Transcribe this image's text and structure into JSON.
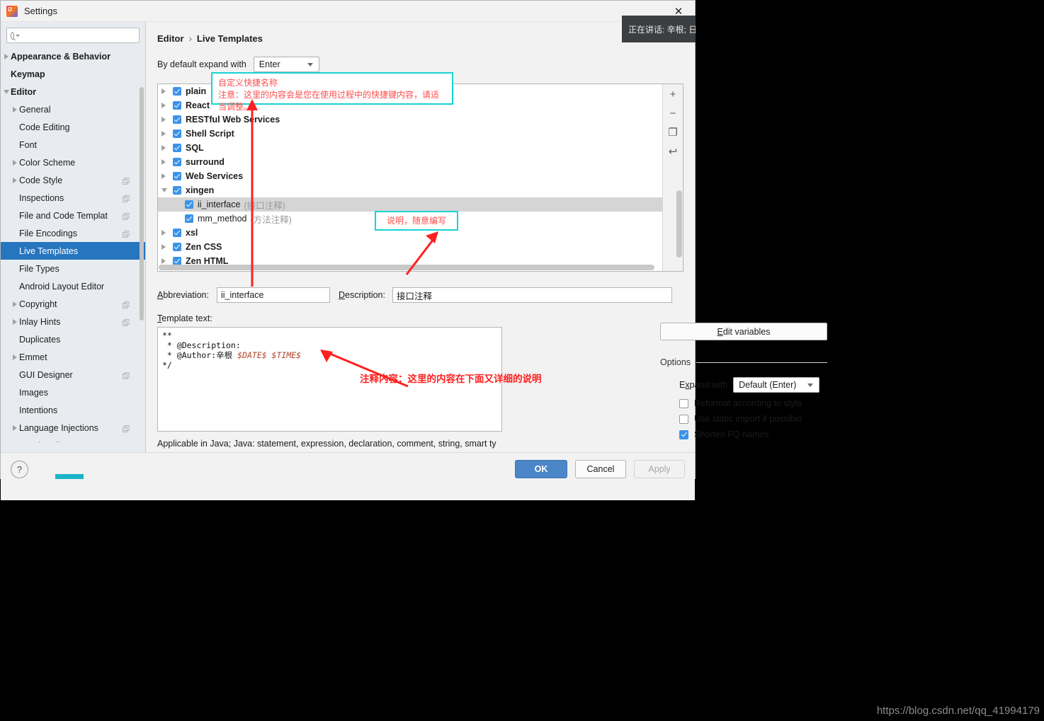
{
  "window": {
    "title": "Settings",
    "logo_icon": "intellij-logo-icon",
    "close_icon": "close-icon"
  },
  "search": {
    "value": "",
    "placeholder": "",
    "icon": "search-icon"
  },
  "sidebar": {
    "items": [
      {
        "label": "Appearance & Behavior",
        "level": 0,
        "arrow": "right",
        "badge": false,
        "selected": false
      },
      {
        "label": "Keymap",
        "level": 0,
        "arrow": "none",
        "badge": false,
        "selected": false
      },
      {
        "label": "Editor",
        "level": 0,
        "arrow": "down",
        "badge": false,
        "selected": false
      },
      {
        "label": "General",
        "level": 1,
        "arrow": "right",
        "badge": false,
        "selected": false
      },
      {
        "label": "Code Editing",
        "level": 1,
        "arrow": "none",
        "badge": false,
        "selected": false
      },
      {
        "label": "Font",
        "level": 1,
        "arrow": "none",
        "badge": false,
        "selected": false
      },
      {
        "label": "Color Scheme",
        "level": 1,
        "arrow": "right",
        "badge": false,
        "selected": false
      },
      {
        "label": "Code Style",
        "level": 1,
        "arrow": "right",
        "badge": true,
        "selected": false
      },
      {
        "label": "Inspections",
        "level": 1,
        "arrow": "none",
        "badge": true,
        "selected": false
      },
      {
        "label": "File and Code Templat",
        "level": 1,
        "arrow": "none",
        "badge": true,
        "selected": false
      },
      {
        "label": "File Encodings",
        "level": 1,
        "arrow": "none",
        "badge": true,
        "selected": false
      },
      {
        "label": "Live Templates",
        "level": 1,
        "arrow": "none",
        "badge": false,
        "selected": true
      },
      {
        "label": "File Types",
        "level": 1,
        "arrow": "none",
        "badge": false,
        "selected": false
      },
      {
        "label": "Android Layout Editor",
        "level": 1,
        "arrow": "none",
        "badge": false,
        "selected": false
      },
      {
        "label": "Copyright",
        "level": 1,
        "arrow": "right",
        "badge": true,
        "selected": false
      },
      {
        "label": "Inlay Hints",
        "level": 1,
        "arrow": "right",
        "badge": true,
        "selected": false
      },
      {
        "label": "Duplicates",
        "level": 1,
        "arrow": "none",
        "badge": false,
        "selected": false
      },
      {
        "label": "Emmet",
        "level": 1,
        "arrow": "right",
        "badge": false,
        "selected": false
      },
      {
        "label": "GUI Designer",
        "level": 1,
        "arrow": "none",
        "badge": true,
        "selected": false
      },
      {
        "label": "Images",
        "level": 1,
        "arrow": "none",
        "badge": false,
        "selected": false
      },
      {
        "label": "Intentions",
        "level": 1,
        "arrow": "none",
        "badge": false,
        "selected": false
      },
      {
        "label": "Language Injections",
        "level": 1,
        "arrow": "right",
        "badge": true,
        "selected": false
      },
      {
        "label": "Proofreading",
        "level": 1,
        "arrow": "right",
        "badge": false,
        "selected": false
      }
    ]
  },
  "breadcrumb": {
    "root": "Editor",
    "separator": "›",
    "current": "Live Templates"
  },
  "expand_default": {
    "label": "By default expand with",
    "value": "Enter"
  },
  "tree": {
    "rows": [
      {
        "name": "plain",
        "desc": "",
        "checked": true,
        "arrow": "right",
        "child": false,
        "selected": false
      },
      {
        "name": "React",
        "desc": "",
        "checked": true,
        "arrow": "right",
        "child": false,
        "selected": false
      },
      {
        "name": "RESTful Web Services",
        "desc": "",
        "checked": true,
        "arrow": "right",
        "child": false,
        "selected": false
      },
      {
        "name": "Shell Script",
        "desc": "",
        "checked": true,
        "arrow": "right",
        "child": false,
        "selected": false
      },
      {
        "name": "SQL",
        "desc": "",
        "checked": true,
        "arrow": "right",
        "child": false,
        "selected": false
      },
      {
        "name": "surround",
        "desc": "",
        "checked": true,
        "arrow": "right",
        "child": false,
        "selected": false
      },
      {
        "name": "Web Services",
        "desc": "",
        "checked": true,
        "arrow": "right",
        "child": false,
        "selected": false
      },
      {
        "name": "xingen",
        "desc": "",
        "checked": true,
        "arrow": "down",
        "child": false,
        "selected": false
      },
      {
        "name": "ii_interface",
        "desc": "(接口注释)",
        "checked": true,
        "arrow": "none",
        "child": true,
        "selected": true
      },
      {
        "name": "mm_method",
        "desc": "(方法注释)",
        "checked": true,
        "arrow": "none",
        "child": true,
        "selected": false
      },
      {
        "name": "xsl",
        "desc": "",
        "checked": true,
        "arrow": "right",
        "child": false,
        "selected": false
      },
      {
        "name": "Zen CSS",
        "desc": "",
        "checked": true,
        "arrow": "right",
        "child": false,
        "selected": false
      },
      {
        "name": "Zen HTML",
        "desc": "",
        "checked": true,
        "arrow": "right",
        "child": false,
        "selected": false
      }
    ],
    "tools": [
      {
        "icon": "plus-icon",
        "glyph": "+"
      },
      {
        "icon": "minus-icon",
        "glyph": "−"
      },
      {
        "icon": "copy-icon",
        "glyph": "❐"
      },
      {
        "icon": "revert-icon",
        "glyph": "↩"
      }
    ]
  },
  "form": {
    "abbreviation_label": "Abbreviation:",
    "abbreviation_value": "ii_interface",
    "description_label": "Description:",
    "description_value": "接口注释",
    "template_text_label": "Template text:",
    "template_line1": "**",
    "template_line2": " * @Description:",
    "template_line3a": " * @Author:辛根 ",
    "template_line3b": "$DATE$ $TIME$",
    "template_line4": "*/",
    "applicable": "Applicable in Java; Java: statement, expression, declaration, comment, string, smart ty"
  },
  "options": {
    "edit_variables_label": "Edit variables",
    "title": "Options",
    "expand_with_label": "Expand with",
    "expand_with_value": "Default (Enter)",
    "checkboxes": [
      {
        "label": "Reformat according to style",
        "checked": false
      },
      {
        "label": "Use static import if possible",
        "checked": false
      },
      {
        "label": "Shorten FQ names",
        "checked": true
      }
    ]
  },
  "footer": {
    "help_glyph": "?",
    "ok_label": "OK",
    "cancel_label": "Cancel",
    "apply_label": "Apply"
  },
  "annotations": {
    "box_abbrev_line1": "自定义快捷名称",
    "box_abbrev_line2": "注意：这里的内容会是您在使用过程中的快捷键内容，请适当调整。",
    "box_desc": "说明，随意编写",
    "template_note": "注释内容：这里的内容在下面又详细的说明",
    "accent_color": "#19d3d3",
    "text_color": "#ff4d4d",
    "arrow_color": "#ff2020"
  },
  "toast": {
    "text": "正在讲话: 辛根; 日"
  },
  "watermark": {
    "text": "https://blog.csdn.net/qq_41994179"
  }
}
